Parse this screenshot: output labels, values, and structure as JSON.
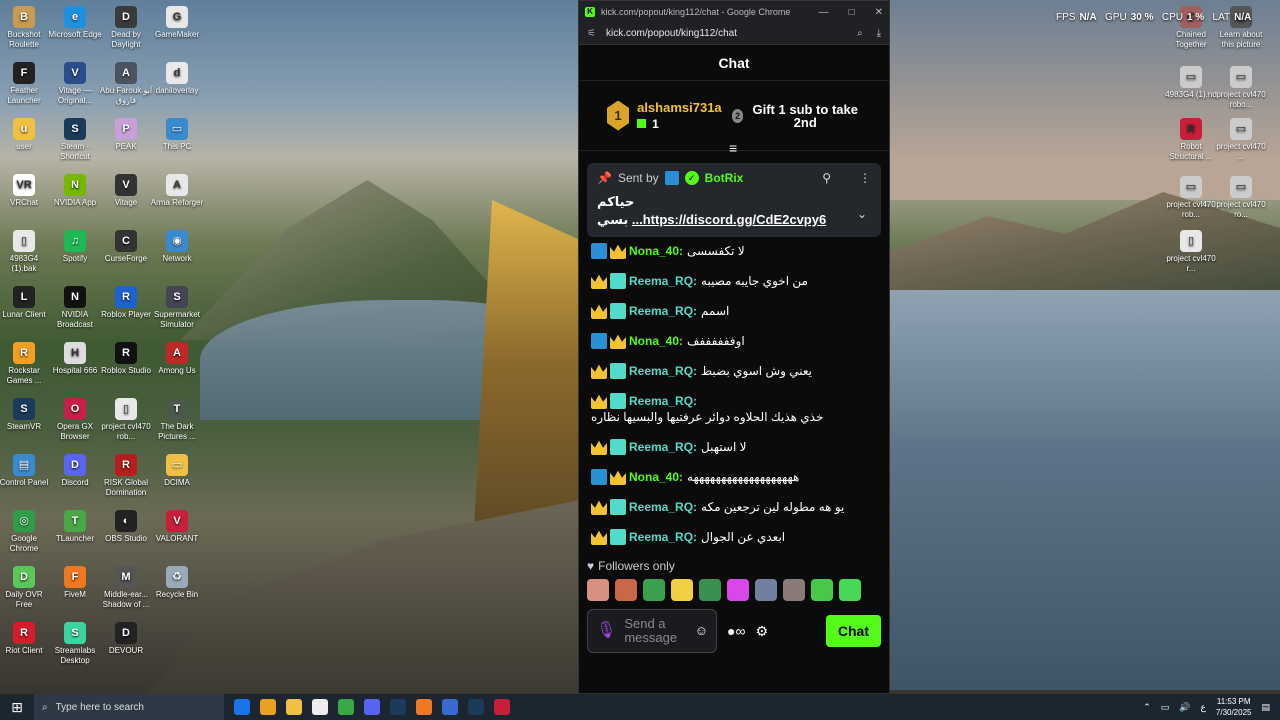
{
  "desktop": {
    "icons": [
      {
        "label": "Buckshot Roulette",
        "color": "#c89b52",
        "glyph": "B"
      },
      {
        "label": "Microsoft Edge",
        "color": "#1f8fe0",
        "glyph": "e"
      },
      {
        "label": "Dead by Daylight",
        "color": "#3a3a3a",
        "glyph": "D"
      },
      {
        "label": "GameMaker",
        "color": "#e8e8e8",
        "glyph": "G"
      },
      {
        "label": "Feather Launcher",
        "color": "#222",
        "glyph": "F"
      },
      {
        "label": "Vitage — Original...",
        "color": "#2a4e8a",
        "glyph": "V"
      },
      {
        "label": "Abu Farouk آبو فاروق",
        "color": "#4a5360",
        "glyph": "A"
      },
      {
        "label": "daniloverlay",
        "color": "#e8e8e8",
        "glyph": "d"
      },
      {
        "label": "user",
        "color": "#f0c044",
        "glyph": "u"
      },
      {
        "label": "Steam - Shortcut",
        "color": "#1b3b5a",
        "glyph": "S"
      },
      {
        "label": "PEAK",
        "color": "#c8a0d8",
        "glyph": "P"
      },
      {
        "label": "This PC",
        "color": "#3a8ad0",
        "glyph": "▭"
      },
      {
        "label": "VRChat",
        "color": "#fff",
        "glyph": "VR"
      },
      {
        "label": "NVIDIA App",
        "color": "#76b900",
        "glyph": "N"
      },
      {
        "label": "Vitage",
        "color": "#333",
        "glyph": "V"
      },
      {
        "label": "Arma Reforger",
        "color": "#e8e8e8",
        "glyph": "A"
      },
      {
        "label": "4983G4 (1).bak",
        "color": "#e8e8e8",
        "glyph": "▯"
      },
      {
        "label": "Spotify",
        "color": "#1db954",
        "glyph": "♫"
      },
      {
        "label": "CurseForge",
        "color": "#333",
        "glyph": "C"
      },
      {
        "label": "Network",
        "color": "#3a8ad0",
        "glyph": "◉"
      },
      {
        "label": "Lunar Client",
        "color": "#222",
        "glyph": "L"
      },
      {
        "label": "NVIDIA Broadcast",
        "color": "#111",
        "glyph": "N"
      },
      {
        "label": "Roblox Player",
        "color": "#1e62d0",
        "glyph": "R"
      },
      {
        "label": "Supermarket Simulator",
        "color": "#445",
        "glyph": "S"
      },
      {
        "label": "Rockstar Games ...",
        "color": "#f0a020",
        "glyph": "R"
      },
      {
        "label": "Hospital 666",
        "color": "#ddd",
        "glyph": "H"
      },
      {
        "label": "Roblox Studio",
        "color": "#111",
        "glyph": "R"
      },
      {
        "label": "Among Us",
        "color": "#c02828",
        "glyph": "A"
      },
      {
        "label": "SteamVR",
        "color": "#1b3b5a",
        "glyph": "S"
      },
      {
        "label": "Opera GX Browser",
        "color": "#c81e4a",
        "glyph": "O"
      },
      {
        "label": "project cvl470 rob...",
        "color": "#e8e8e8",
        "glyph": "▯"
      },
      {
        "label": "The Dark Pictures ...",
        "color": "#4a5a4a",
        "glyph": "T"
      },
      {
        "label": "Control Panel",
        "color": "#3a8ad0",
        "glyph": "▤"
      },
      {
        "label": "Discord",
        "color": "#5865f2",
        "glyph": "D"
      },
      {
        "label": "RISK Global Domination",
        "color": "#b81c1c",
        "glyph": "R"
      },
      {
        "label": "DCIMA",
        "color": "#f0c044",
        "glyph": "▭"
      },
      {
        "label": "Google Chrome",
        "color": "#2f9d48",
        "glyph": "◎"
      },
      {
        "label": "TLauncher",
        "color": "#48a848",
        "glyph": "T"
      },
      {
        "label": "OBS Studio",
        "color": "#222",
        "glyph": "◐"
      },
      {
        "label": "VALORANT",
        "color": "#c81e3a",
        "glyph": "V"
      },
      {
        "label": "Daily OVR Free",
        "color": "#58c858",
        "glyph": "D"
      },
      {
        "label": "FiveM",
        "color": "#f07820",
        "glyph": "F"
      },
      {
        "label": "Middle-ear... Shadow of ...",
        "color": "#555",
        "glyph": "M"
      },
      {
        "label": "Recycle Bin",
        "color": "#9ab",
        "glyph": "♻"
      },
      {
        "label": "Riot Client",
        "color": "#d81c2c",
        "glyph": "R"
      },
      {
        "label": "Streamlabs Desktop",
        "color": "#3ad6a0",
        "glyph": "S"
      },
      {
        "label": "DEVOUR",
        "color": "#222",
        "glyph": "D"
      }
    ],
    "right_icons": [
      {
        "label": "Chained Together",
        "color": "#a06060",
        "glyph": "C"
      },
      {
        "label": "Learn about this picture",
        "color": "#555",
        "glyph": "◷"
      },
      {
        "label": "4983G4 (1).nd",
        "color": "#ccc",
        "glyph": "▭"
      },
      {
        "label": "project cvl470 robo...",
        "color": "#ccc",
        "glyph": "▭"
      },
      {
        "label": "Robot Structural ...",
        "color": "#c81e3a",
        "glyph": "R"
      },
      {
        "label": "project cvl470 ...",
        "color": "#ccc",
        "glyph": "▭"
      },
      {
        "label": "project cvl470 rob...",
        "color": "#ccc",
        "glyph": "▭"
      },
      {
        "label": "project cvl470 ro...",
        "color": "#ccc",
        "glyph": "▭"
      },
      {
        "label": "project cvl470 r...",
        "color": "#e8e8e8",
        "glyph": "▯"
      }
    ]
  },
  "perf": {
    "fps_label": "FPS",
    "fps_value": "N/A",
    "gpu_label": "GPU",
    "gpu_value": "30 %",
    "cpu_label": "CPU",
    "cpu_value": "1 %",
    "lat_label": "LAT",
    "lat_value": "N/A"
  },
  "window": {
    "title": "kick.com/popout/king112/chat - Google Chrome",
    "url": "kick.com/popout/king112/chat",
    "minimize": "—",
    "maximize": "□",
    "close": "✕"
  },
  "chat": {
    "header": "Chat",
    "top_gifter": {
      "rank": "1",
      "name": "alshamsi731a",
      "count": "1",
      "second_rank": "2",
      "second_text": "Gift 1 sub to take 2nd"
    },
    "pinned": {
      "sent_by": "Sent by",
      "author": "BotRix",
      "line1": "حياكم",
      "link": "https://discord.gg/CdE2cvpy6...",
      "line2": "بسي"
    },
    "messages": [
      {
        "badges": [
          "mod",
          "crown"
        ],
        "user": "Nona_40:",
        "color": "green",
        "text": "لا تكفسسى"
      },
      {
        "badges": [
          "crown",
          "sub"
        ],
        "user": "Reema_RQ:",
        "color": "teal",
        "text": "من اخوي جايبه مصيبه"
      },
      {
        "badges": [
          "crown",
          "sub"
        ],
        "user": "Reema_RQ:",
        "color": "teal",
        "text": "اسمم"
      },
      {
        "badges": [
          "mod",
          "crown"
        ],
        "user": "Nona_40:",
        "color": "green",
        "text": "اوففففففف"
      },
      {
        "badges": [
          "crown",
          "sub"
        ],
        "user": "Reema_RQ:",
        "color": "teal",
        "text": "يعني وش اسوي بضبط"
      },
      {
        "badges": [
          "crown",
          "sub"
        ],
        "user": "Reema_RQ:",
        "color": "teal",
        "text": "خذي هذيك الحلاوه دوائر عرفتيها والبسيها نظاره"
      },
      {
        "badges": [
          "crown",
          "sub"
        ],
        "user": "Reema_RQ:",
        "color": "teal",
        "text": "لا استهبل"
      },
      {
        "badges": [
          "mod",
          "crown"
        ],
        "user": "Nona_40:",
        "color": "green",
        "text": "هههههههههههههههههههه"
      },
      {
        "badges": [
          "crown",
          "sub"
        ],
        "user": "Reema_RQ:",
        "color": "teal",
        "text": "يو هه مطوله لين ترجعين مكه"
      },
      {
        "badges": [
          "crown",
          "sub"
        ],
        "user": "Reema_RQ:",
        "color": "teal",
        "text": "ابعدي عن الجوال"
      }
    ],
    "followers_only": "Followers only",
    "emote_colors": [
      "#d89080",
      "#c86848",
      "#3aa050",
      "#f0d040",
      "#3a9050",
      "#d848e8",
      "#7080a0",
      "#8a7a78",
      "#48c848",
      "#48d858"
    ],
    "input_placeholder": "Send a message",
    "send_label": "Chat"
  },
  "taskbar": {
    "search_placeholder": "Type here to search",
    "time": "11:53 PM",
    "date": "7/30/2025",
    "lang": "ع",
    "apps": [
      "#1a73e8",
      "#e8a020",
      "#f0c040",
      "#eee",
      "#3aa848",
      "#5865f2",
      "#1b3b5a",
      "#f07820",
      "#3a6ad0",
      "#1b3b5a",
      "#c81e3a"
    ]
  }
}
